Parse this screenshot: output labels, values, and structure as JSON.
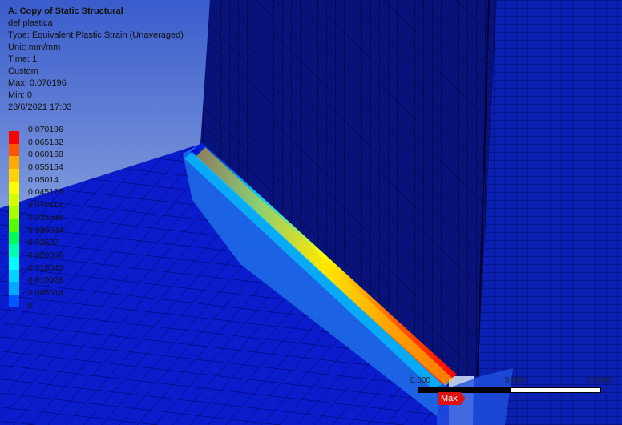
{
  "result": {
    "title": "A: Copy of Static Structural",
    "name": "def plastica",
    "type": "Type: Equivalent Plastic Strain (Unaveraged)",
    "unit": "Unit: mm/mm",
    "time": "Time: 1",
    "mode": "Custom",
    "max": "Max: 0.070196",
    "min": "Min: 0",
    "date": "28/6/2021 17:03"
  },
  "legend": {
    "levels": [
      {
        "value": "0.070196",
        "color": "#ff0000"
      },
      {
        "value": "0.065182",
        "color": "#ff5500"
      },
      {
        "value": "0.060168",
        "color": "#ffaa00"
      },
      {
        "value": "0.055154",
        "color": "#ffd400"
      },
      {
        "value": "0.05014",
        "color": "#ffff00"
      },
      {
        "value": "0.045126",
        "color": "#d4ff00"
      },
      {
        "value": "0.040112",
        "color": "#a8ff00"
      },
      {
        "value": "0.035098",
        "color": "#55ff00"
      },
      {
        "value": "0.030084",
        "color": "#00ff55"
      },
      {
        "value": "0.02507",
        "color": "#00ffaa"
      },
      {
        "value": "0.020056",
        "color": "#00ffff"
      },
      {
        "value": "0.015042",
        "color": "#00d4ff"
      },
      {
        "value": "0.010028",
        "color": "#00aaff"
      },
      {
        "value": "0.005014",
        "color": "#0055ff"
      },
      {
        "value": "0",
        "color": "#0000ff"
      }
    ]
  },
  "scale": {
    "left": "0.000",
    "mid": "5.000",
    "right": "10.000"
  },
  "probe": {
    "label": "Max"
  },
  "colors": {
    "bg_top": "#3c5ac8",
    "bg_bottom": "#b8c8e8",
    "mesh": "#00009a"
  }
}
